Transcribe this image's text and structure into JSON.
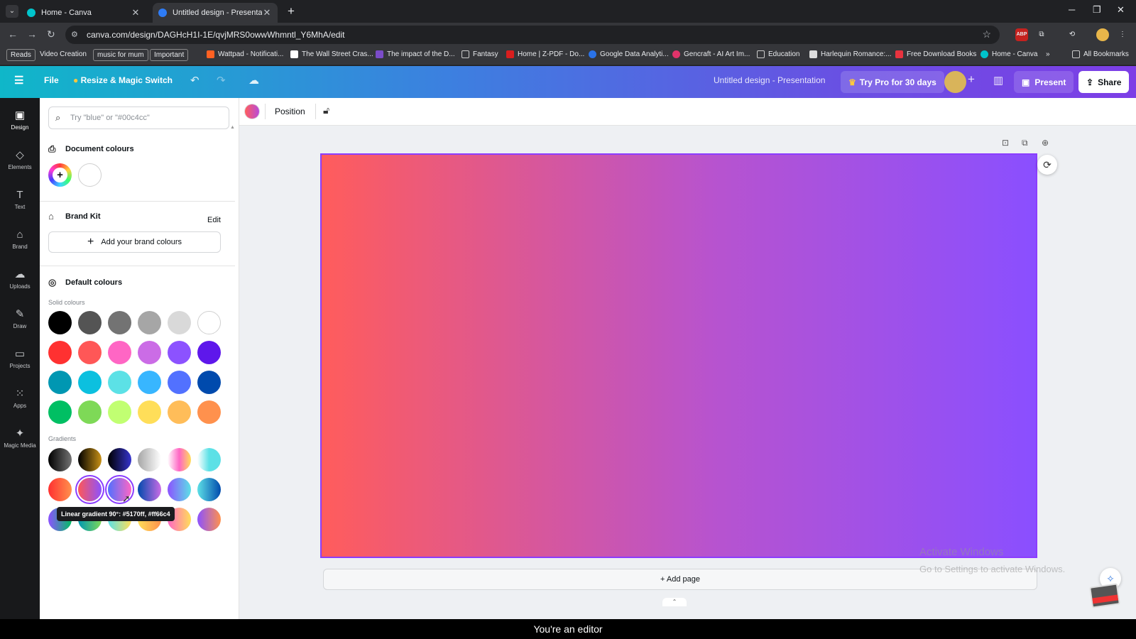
{
  "browser": {
    "tabs": [
      {
        "title": "Home - Canva",
        "favicon_color": "#00c4cc"
      },
      {
        "title": "Untitled design - Presentation",
        "favicon_color": "#2e7cf6"
      }
    ],
    "url": "canva.com/design/DAGHcH1I-1E/qvjMRS0owwWhmntl_Y6MhA/edit",
    "extensions": [
      "ABP"
    ],
    "bookmarks": [
      {
        "label": "Reads",
        "chip": true
      },
      {
        "label": "Video Creation",
        "chip": false
      },
      {
        "label": "music for mum",
        "chip": true
      },
      {
        "label": "Important",
        "chip": true
      },
      {
        "label": "Wattpad - Notificati...",
        "icon_color": "#ff6122"
      },
      {
        "label": "The Wall Street Cras...",
        "icon_color": "#ffffff"
      },
      {
        "label": "The impact of the D...",
        "icon_color": "#7b4cc9"
      },
      {
        "label": "Fantasy",
        "icon_color": "folder"
      },
      {
        "label": "Home | Z-PDF - Do...",
        "icon_color": "#d91e1e"
      },
      {
        "label": "Google Data Analyti...",
        "icon_color": "#2a73e8"
      },
      {
        "label": "Gencraft - AI Art Im...",
        "icon_color": "#e0336a"
      },
      {
        "label": "Education",
        "icon_color": "folder"
      },
      {
        "label": "Harlequin Romance:...",
        "icon_color": "#dddddd"
      },
      {
        "label": "Free Download Books",
        "icon_color": "#e8333f"
      },
      {
        "label": "Home - Canva",
        "icon_color": "#00c4cc"
      }
    ],
    "bookmarks_overflow": "»",
    "all_bookmarks": "All Bookmarks"
  },
  "canva": {
    "file": "File",
    "resize": "Resize & Magic Switch",
    "design_title": "Untitled design - Presentation",
    "try_pro": "Try Pro for 30 days",
    "present": "Present",
    "share": "Share",
    "rail": [
      {
        "label": "Design",
        "icon": "design-icon"
      },
      {
        "label": "Elements",
        "icon": "elements-icon"
      },
      {
        "label": "Text",
        "icon": "text-icon"
      },
      {
        "label": "Brand",
        "icon": "brand-icon"
      },
      {
        "label": "Uploads",
        "icon": "uploads-icon"
      },
      {
        "label": "Draw",
        "icon": "draw-icon"
      },
      {
        "label": "Projects",
        "icon": "projects-icon"
      },
      {
        "label": "Apps",
        "icon": "apps-icon"
      },
      {
        "label": "Magic Media",
        "icon": "magic-media-icon"
      }
    ],
    "panel": {
      "search_placeholder": "Try \"blue\" or \"#00c4cc\"",
      "document_colours": "Document colours",
      "document_swatches": [
        "#ffffff"
      ],
      "brand_kit": "Brand Kit",
      "edit": "Edit",
      "add_brand": "Add your brand colours",
      "default_colours": "Default colours",
      "solid_label": "Solid colours",
      "solid": [
        [
          "#000000",
          "#545454",
          "#737373",
          "#a6a6a6",
          "#d9d9d9",
          "#ffffff"
        ],
        [
          "#ff3131",
          "#ff5757",
          "#ff66c4",
          "#cb6ce6",
          "#8c52ff",
          "#5e17eb"
        ],
        [
          "#0097b2",
          "#0cc0df",
          "#5ce1e6",
          "#38b6ff",
          "#5271ff",
          "#004aad"
        ],
        [
          "#00bf63",
          "#7ed957",
          "#c1ff72",
          "#ffde59",
          "#ffbd59",
          "#ff914d"
        ]
      ],
      "gradients_label": "Gradients",
      "gradients": [
        [
          "linear-gradient(90deg,#000000,#737373)",
          "linear-gradient(90deg,#000000,#c89116)",
          "linear-gradient(90deg,#000000,#3533cd)",
          "linear-gradient(90deg,#a6a6a6,#ffffff)",
          "linear-gradient(90deg,#ffffff,#ff66c4,#ffde59)",
          "linear-gradient(90deg,#ffffff,#5ce1e6,#5de0e6)"
        ],
        [
          "linear-gradient(90deg,#ff3131,#ff914d)",
          "linear-gradient(90deg,#ff5757,#8c52ff)",
          "linear-gradient(90deg,#5170ff,#ff66c4)",
          "linear-gradient(90deg,#004aad,#cb6ce6)",
          "linear-gradient(90deg,#8c52ff,#5ce1e6)",
          "linear-gradient(90deg,#5de0e6,#004aad)"
        ],
        [
          "linear-gradient(90deg,#8c52ff,#00bf63)",
          "linear-gradient(90deg,#0097b2,#7ed957)",
          "linear-gradient(90deg,#5ce1e6,#ffde59)",
          "linear-gradient(90deg,#ffde59,#ff914d)",
          "linear-gradient(90deg,#ff66c4,#ffde59)",
          "linear-gradient(90deg,#8c52ff,#ff914d)"
        ]
      ],
      "tooltip": "Linear gradient 90°: #5170ff, #ff66c4"
    },
    "toolbar": {
      "position": "Position"
    },
    "page_gradient": {
      "from": "#ff5c5c",
      "to": "#8a4fff"
    },
    "add_page": "+ Add page",
    "watermark": [
      "Activate Windows",
      "Go to Settings to activate Windows."
    ]
  },
  "caption": "You're an editor"
}
